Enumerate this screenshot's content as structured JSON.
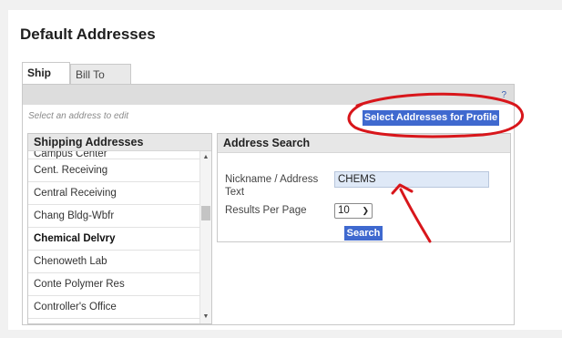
{
  "page": {
    "title": "Default Addresses"
  },
  "tabs": [
    {
      "label": "Ship To",
      "active": true
    },
    {
      "label": "Bill To",
      "active": false
    }
  ],
  "toolbar": {
    "help_label": "?"
  },
  "hint": "Select an address to edit",
  "select_profile_button": "Select Addresses for Profile",
  "shipping": {
    "header": "Shipping Addresses",
    "items": [
      {
        "label": "Campus Center"
      },
      {
        "label": "Cent. Receiving"
      },
      {
        "label": "Central Receiving"
      },
      {
        "label": "Chang Bldg-Wbfr"
      },
      {
        "label": "Chemical Delvry",
        "bold": true
      },
      {
        "label": "Chenoweth Lab"
      },
      {
        "label": "Conte Polymer Res"
      },
      {
        "label": "Controller's Office"
      }
    ]
  },
  "address_search": {
    "header": "Address Search",
    "nickname_label": "Nickname / Address Text",
    "nickname_value": "CHEMS",
    "results_label": "Results Per Page",
    "results_value": "10",
    "search_button": "Search"
  },
  "colors": {
    "accent": "#3f69cf",
    "annotation": "#d8161b"
  }
}
